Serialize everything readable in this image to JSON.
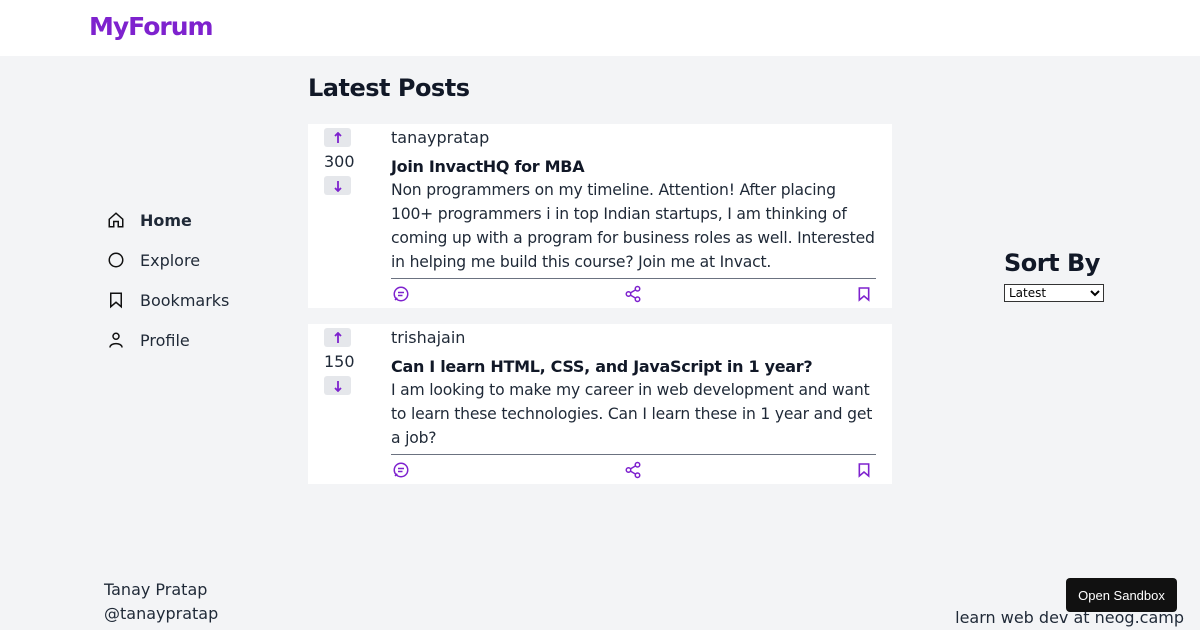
{
  "header": {
    "logo": "MyForum"
  },
  "sidebar": {
    "items": [
      {
        "label": "Home",
        "icon": "home-icon"
      },
      {
        "label": "Explore",
        "icon": "explore-icon"
      },
      {
        "label": "Bookmarks",
        "icon": "bookmark-icon"
      },
      {
        "label": "Profile",
        "icon": "user-icon"
      }
    ]
  },
  "main": {
    "title": "Latest Posts",
    "posts": [
      {
        "votes": "300",
        "username": "tanaypratap",
        "title": "Join InvactHQ for MBA",
        "body": "Non programmers on my timeline. Attention! After placing 100+ programmers i in top Indian startups, I am thinking of coming up with a program for business roles as well. Interested in helping me build this course? Join me at Invact."
      },
      {
        "votes": "150",
        "username": "trishajain",
        "title": "Can I learn HTML, CSS, and JavaScript in 1 year?",
        "body": "I am looking to make my career in web development and want to learn these technologies. Can I learn these in 1 year and get a job?"
      }
    ]
  },
  "sort": {
    "title": "Sort By",
    "selected": "Latest"
  },
  "footer": {
    "name": "Tanay Pratap",
    "handle": "@tanaypratap",
    "promo": "learn web dev at neog.camp"
  },
  "sandbox_button": "Open Sandbox",
  "colors": {
    "accent": "#7e22ce",
    "background": "#f3f4f6",
    "card": "#ffffff"
  }
}
